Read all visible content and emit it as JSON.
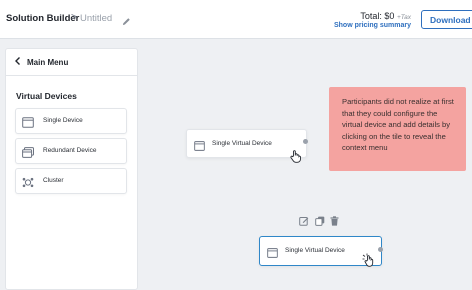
{
  "header": {
    "breadcrumb_root": "Solution Builder",
    "breadcrumb_separator": ">",
    "breadcrumb_leaf": "Untitled",
    "total_label": "Total: $0",
    "total_tax": "+Tax",
    "pricing_link": "Show pricing summary",
    "download_label": "Download I"
  },
  "sidebar": {
    "back_label": "Main Menu",
    "section_title": "Virtual Devices",
    "items": [
      {
        "label": "Single Device",
        "icon": "window-icon"
      },
      {
        "label": "Redundant Device",
        "icon": "stacked-window-icon"
      },
      {
        "label": "Cluster",
        "icon": "cluster-icon"
      }
    ]
  },
  "canvas": {
    "tile1_label": "Single Virtual Device",
    "tile2_label": "Single Virtual Device",
    "context_actions": [
      "edit-icon",
      "copy-icon",
      "trash-icon"
    ],
    "note": "Participants did not realize at first that they could configure the virtual device and add details by clicking on the tile to reveal the context menu"
  },
  "colors": {
    "accent": "#2e6fbe",
    "note_bg": "#f4a3a0",
    "selected_border": "#2f87c8",
    "canvas_bg": "#eef0f3"
  }
}
